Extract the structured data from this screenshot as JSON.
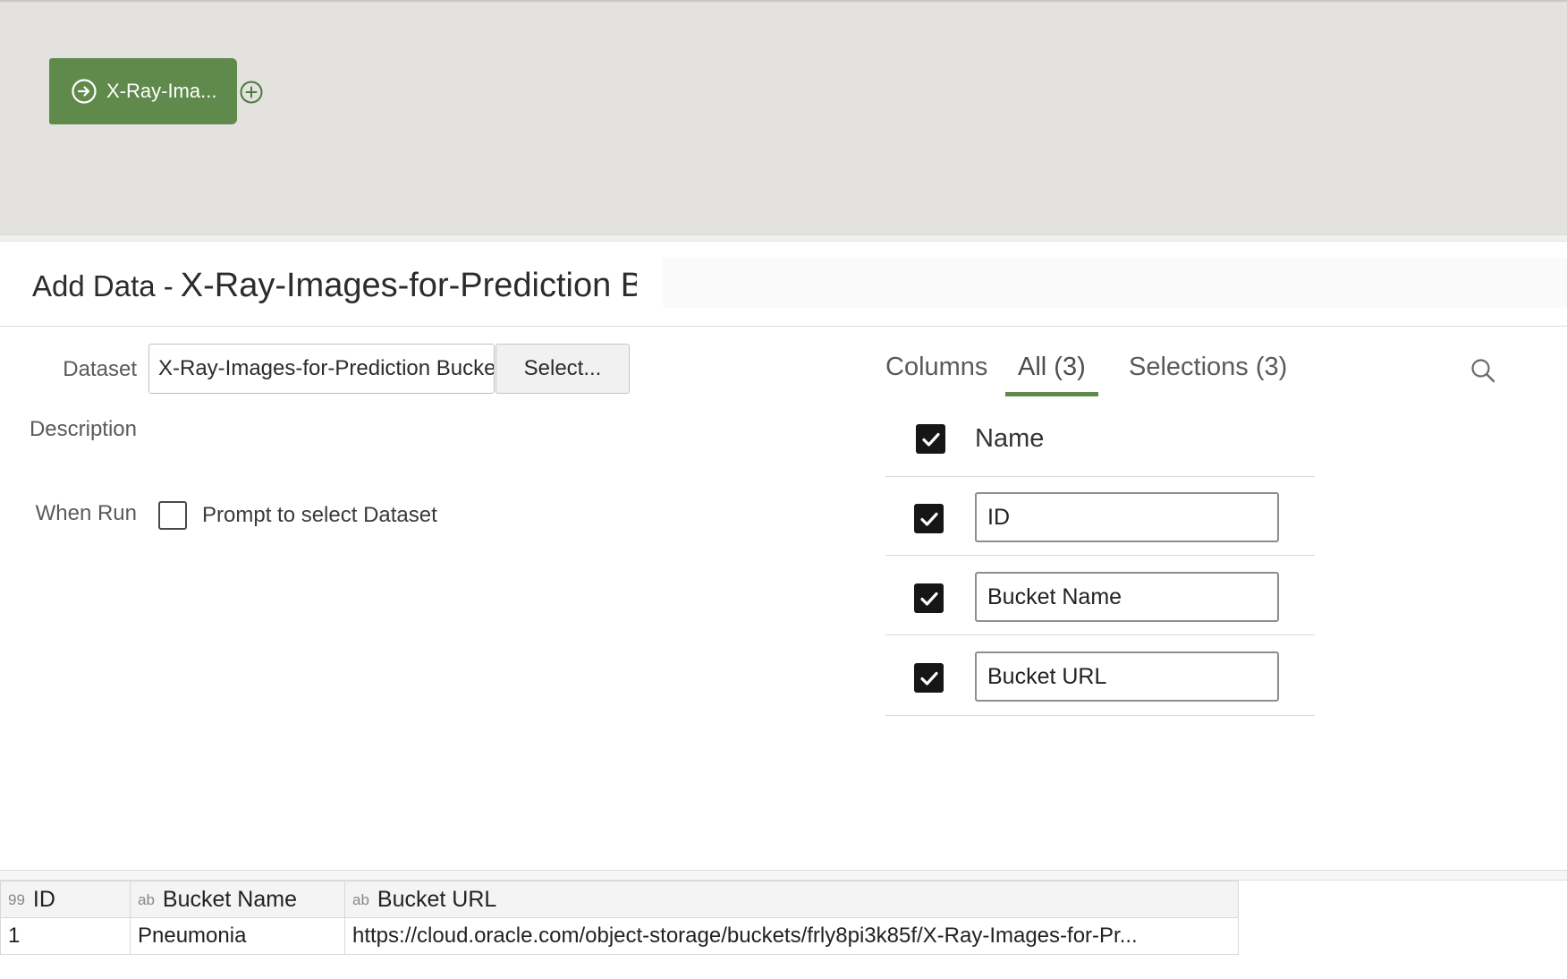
{
  "canvas": {
    "node": {
      "label": "X-Ray-Ima...",
      "icon": "arrow-circle-right-icon",
      "color": "#5f8a4c"
    },
    "add_icon": "plus-circle-icon"
  },
  "header": {
    "title_prefix": "Add Data -",
    "title_name": "X-Ray-Images-for-Prediction Bucket"
  },
  "form": {
    "dataset_label": "Dataset",
    "dataset_value": "X-Ray-Images-for-Prediction Bucket",
    "select_button": "Select...",
    "description_label": "Description",
    "when_run_label": "When Run",
    "prompt_checkbox_label": "Prompt to select Dataset",
    "prompt_checked": false
  },
  "columns_panel": {
    "title": "Columns",
    "tabs": [
      {
        "label": "All (3)",
        "active": true
      },
      {
        "label": "Selections (3)",
        "active": false
      }
    ],
    "name_header": "Name",
    "rows": [
      {
        "name": "ID",
        "checked": true
      },
      {
        "name": "Bucket Name",
        "checked": true
      },
      {
        "name": "Bucket URL",
        "checked": true
      }
    ],
    "accent_color": "#5f8a4c"
  },
  "grid": {
    "headers": [
      {
        "type": "99",
        "label": "ID"
      },
      {
        "type": "ab",
        "label": "Bucket Name"
      },
      {
        "type": "ab",
        "label": "Bucket URL"
      }
    ],
    "rows": [
      [
        "1",
        "Pneumonia",
        "https://cloud.oracle.com/object-storage/buckets/frly8pi3k85f/X-Ray-Images-for-Pr..."
      ]
    ]
  }
}
